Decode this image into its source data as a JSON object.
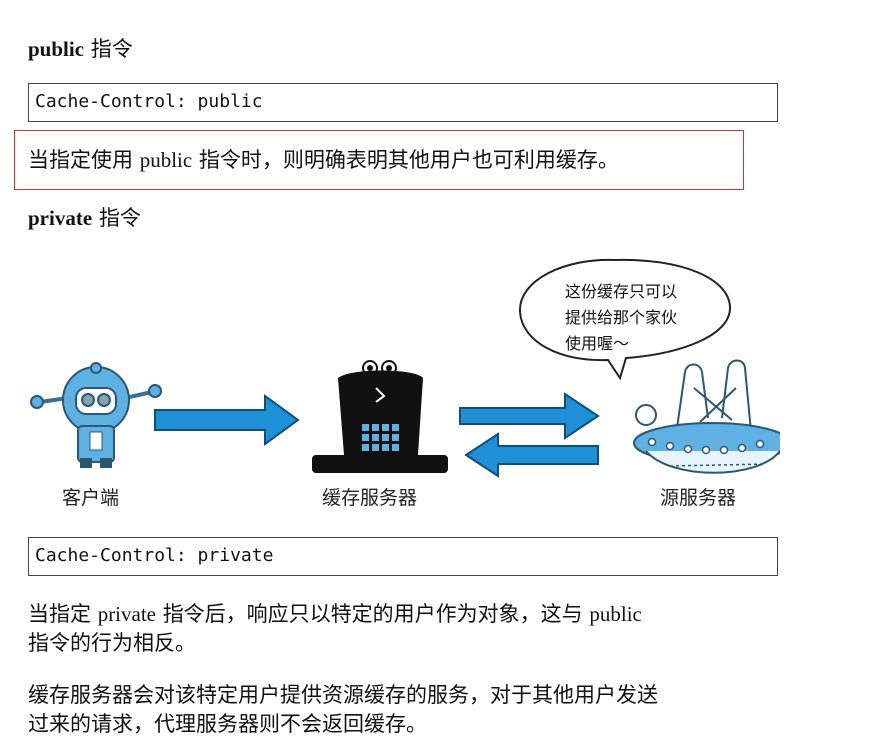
{
  "section_public": {
    "heading_keyword": "public",
    "heading_suffix": "指令",
    "code": "Cache-Control: public",
    "highlight_p1": "当指定使用",
    "highlight_kw": "public",
    "highlight_p2": "指令时，则明确表明其他用户也可利用缓存。"
  },
  "section_private": {
    "heading_keyword": "private",
    "heading_suffix": "指令",
    "code": "Cache-Control: private",
    "para1_l1_a": "当指定",
    "para1_l1_kw1": "private",
    "para1_l1_b": "指令后，响应只以特定的用户作为对象，这与",
    "para1_l1_kw2": "public",
    "para1_l2": "指令的行为相反。",
    "para2_l1": "缓存服务器会对该特定用户提供资源缓存的服务，对于其他用户发送",
    "para2_l2": "过来的请求，代理服务器则不会返回缓存。"
  },
  "diagram": {
    "client_label": "客户端",
    "cache_label": "缓存服务器",
    "origin_label": "源服务器",
    "bubble_line1": "这份缓存只可以",
    "bubble_line2": "提供给那个家伙",
    "bubble_line3": "使用喔～",
    "icons": [
      "robot-client-icon",
      "top-hat-cache-server-icon",
      "ufo-origin-server-icon",
      "arrow-right-icon",
      "arrow-left-icon",
      "speech-bubble-icon"
    ],
    "arrow_color": "#1f8fd6",
    "robot_color": "#5fb1e3"
  },
  "colors": {
    "highlight_border": "#d8312b",
    "code_border": "#444444"
  }
}
